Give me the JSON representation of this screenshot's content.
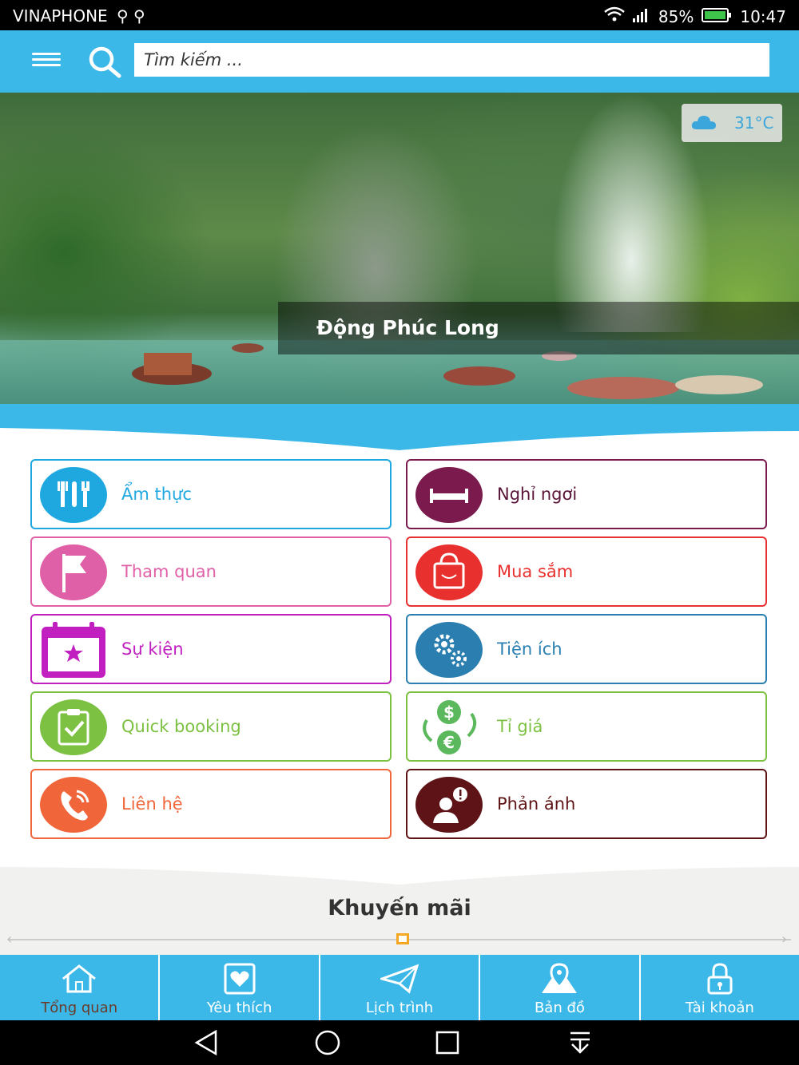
{
  "status": {
    "carrier": "VINAPHONE",
    "battery": "85%",
    "time": "10:47"
  },
  "search": {
    "placeholder": "Tìm kiếm ..."
  },
  "hero": {
    "caption": "Động Phúc Long",
    "weather": "31°C"
  },
  "menu": [
    {
      "label": "Ẩm thực",
      "icon": "utensils-icon",
      "color": "#1fa8e0"
    },
    {
      "label": "Nghỉ ngơi",
      "icon": "bed-icon",
      "color": "#7b1b4d"
    },
    {
      "label": "Tham quan",
      "icon": "flag-icon",
      "color": "#e060a8"
    },
    {
      "label": "Mua sắm",
      "icon": "shopping-bag-icon",
      "color": "#e8312f"
    },
    {
      "label": "Sự kiện",
      "icon": "calendar-star-icon",
      "color": "#c11fc0"
    },
    {
      "label": "Tiện ích",
      "icon": "gears-icon",
      "color": "#2a7fb0"
    },
    {
      "label": "Quick booking",
      "icon": "clipboard-check-icon",
      "color": "#7cc142"
    },
    {
      "label": "Tỉ giá",
      "icon": "currency-exchange-icon",
      "color": "#7cc142"
    },
    {
      "label": "Liên hệ",
      "icon": "phone-icon",
      "color": "#f0663a"
    },
    {
      "label": "Phản ánh",
      "icon": "user-alert-icon",
      "color": "#5e1416"
    }
  ],
  "promo": {
    "title": "Khuyến mãi"
  },
  "tabs": [
    {
      "label": "Tổng quan",
      "icon": "home-icon",
      "active": true
    },
    {
      "label": "Yêu thích",
      "icon": "heart-icon"
    },
    {
      "label": "Lịch trình",
      "icon": "paper-plane-icon"
    },
    {
      "label": "Bản đồ",
      "icon": "map-pin-icon"
    },
    {
      "label": "Tài khoản",
      "icon": "lock-icon"
    }
  ]
}
